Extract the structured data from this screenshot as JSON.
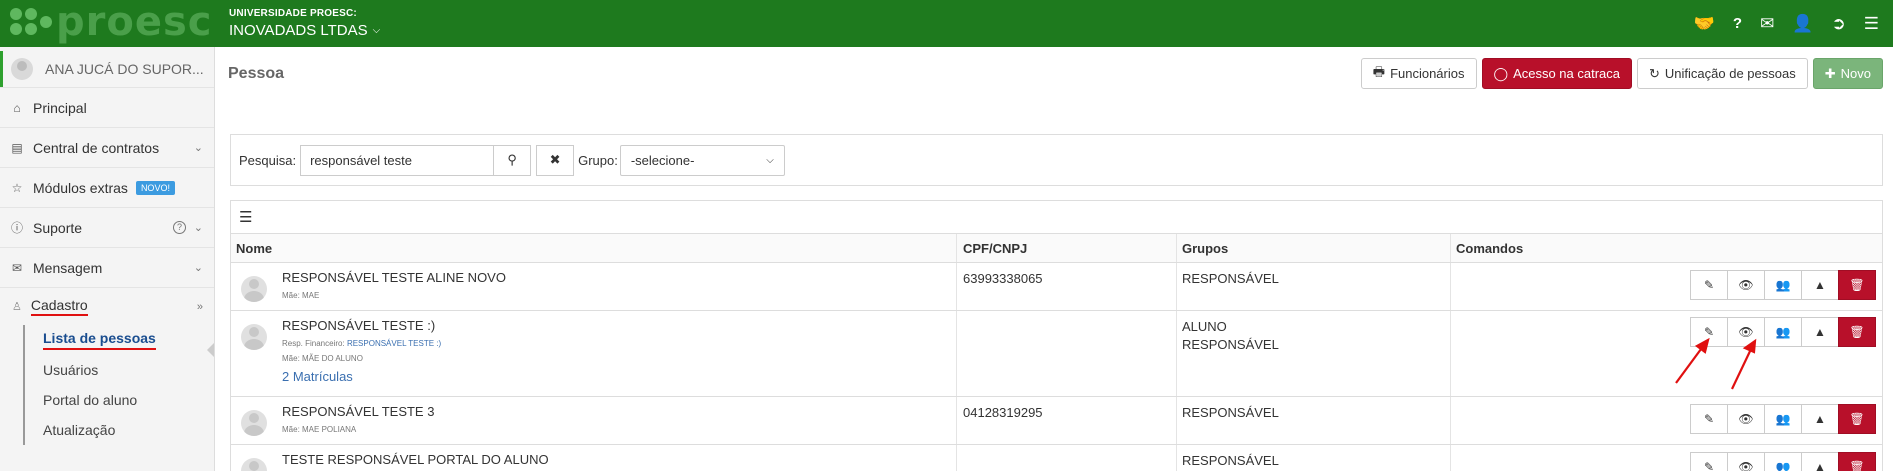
{
  "header": {
    "logo_text": "proesc",
    "university": "UNIVERSIDADE PROESC:",
    "company": "INOVADADS LTDAS",
    "icons": [
      "handshake-icon",
      "question-icon",
      "envelope-icon",
      "user-icon",
      "sign-out-icon",
      "menu-icon"
    ]
  },
  "sidebar": {
    "user_name": "ANA JUCÁ DO SUPOR...",
    "items": [
      {
        "label": "Principal",
        "icon": "home-icon"
      },
      {
        "label": "Central de contratos",
        "icon": "document-icon"
      },
      {
        "label": "Módulos extras",
        "icon": "star-icon",
        "badge": "NOVO!"
      },
      {
        "label": "Suporte",
        "icon": "info-icon"
      },
      {
        "label": "Mensagem",
        "icon": "envelope-icon"
      }
    ],
    "cadastro": {
      "label": "Cadastro",
      "subitems": [
        "Lista de pessoas",
        "Usuários",
        "Portal do aluno",
        "Atualização"
      ]
    }
  },
  "main": {
    "title": "Pessoa",
    "actions": {
      "funcionarios": "Funcionários",
      "acesso": "Acesso na catraca",
      "unificacao": "Unificação de pessoas",
      "novo": "Novo"
    },
    "search": {
      "label": "Pesquisa:",
      "value": "responsável teste",
      "group_label": "Grupo:",
      "group_value": "-selecione-"
    },
    "table": {
      "headers": [
        "Nome",
        "CPF/CNPJ",
        "Grupos",
        "Comandos"
      ],
      "rows": [
        {
          "name": "RESPONSÁVEL TESTE ALINE NOVO",
          "mae": "Mãe: MAE",
          "cpf": "63993338065",
          "grupos": [
            "RESPONSÁVEL"
          ]
        },
        {
          "name": "RESPONSÁVEL TESTE :)",
          "resp_label": "Resp. Financeiro:",
          "resp_value": "RESPONSÁVEL TESTE :)",
          "mae": "Mãe: MÃE DO ALUNO",
          "matriculas": "2 Matrículas",
          "cpf": "",
          "grupos": [
            "ALUNO",
            "RESPONSÁVEL"
          ]
        },
        {
          "name": "RESPONSÁVEL TESTE 3",
          "mae": "Mãe: MAE POLIANA",
          "cpf": "04128319295",
          "grupos": [
            "RESPONSÁVEL"
          ]
        },
        {
          "name": "TESTE RESPONSÁVEL PORTAL DO ALUNO",
          "mae": "",
          "cpf": "",
          "grupos": [
            "RESPONSÁVEL"
          ]
        }
      ]
    }
  },
  "colors": {
    "brand": "#1e7a1e",
    "danger": "#b8102a",
    "success": "#7bb57b",
    "link": "#3a6fb0",
    "annotation": "#e01010"
  }
}
